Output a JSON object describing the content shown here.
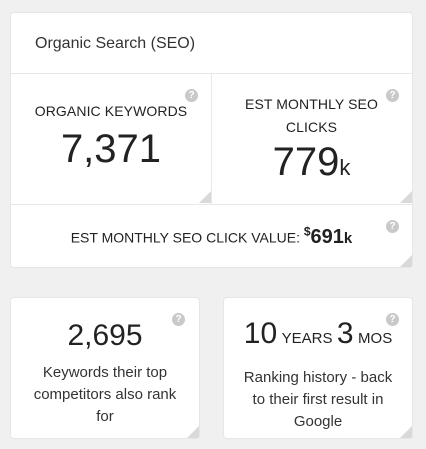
{
  "header": {
    "title": "Organic Search (SEO)"
  },
  "organic_keywords": {
    "label": "ORGANIC KEYWORDS",
    "value": "7,371"
  },
  "monthly_clicks": {
    "label_line1": "EST MONTHLY SEO",
    "label_line2": "CLICKS",
    "value": "779",
    "suffix": "k"
  },
  "click_value": {
    "label": "EST MONTHLY SEO CLICK VALUE:",
    "currency": "$",
    "value": "691",
    "suffix": "k"
  },
  "competitors": {
    "value": "2,695",
    "desc_line1": "Keywords their top",
    "desc_line2": "competitors also rank",
    "desc_line3": "for"
  },
  "history": {
    "years": "10",
    "years_unit": "YEARS",
    "months": "3",
    "months_unit": "MOS",
    "desc_line1": "Ranking history - back",
    "desc_line2": "to their first result in",
    "desc_line3": "Google"
  },
  "help_glyph": "?",
  "icons": {
    "help": "question-circle-icon",
    "corner": "corner-fold-icon"
  },
  "colors": {
    "background": "#f0f0f0",
    "card": "#ffffff",
    "help_icon": "#c9c9c9",
    "corner": "#d9d9d9"
  }
}
